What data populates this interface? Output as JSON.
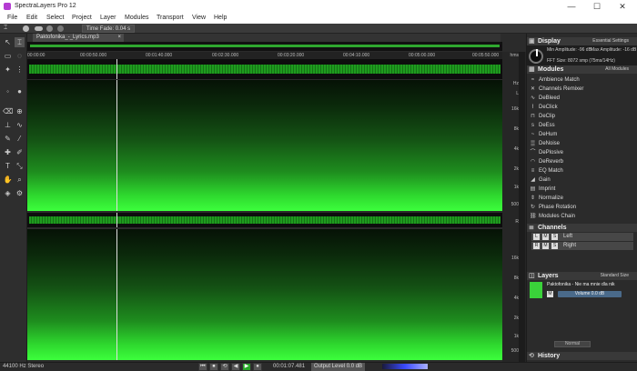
{
  "app": {
    "title": "SpectraLayers Pro 12"
  },
  "window_controls": {
    "minimize": "—",
    "maximize": "☐",
    "close": "✕"
  },
  "menu": [
    "File",
    "Edit",
    "Select",
    "Project",
    "Layer",
    "Modules",
    "Transport",
    "View",
    "Help"
  ],
  "tool_options": {
    "time_fade": "Time Fade: 0.04 s"
  },
  "document": {
    "tab_label": "Paktofonika_-_Lyrics.mp3",
    "tab_close": "×"
  },
  "ruler": {
    "hms": "hms",
    "ticks": [
      "00:00:00",
      "00:00:50.000",
      "00:01:40.000",
      "00:02:30.000",
      "00:03:20.000",
      "00:04:10.000",
      "00:05:00.000",
      "00:05:50.000"
    ]
  },
  "freq_axis": {
    "hz": "Hz",
    "left_labels": [
      "L",
      "16k",
      "8k",
      "4k",
      "2k",
      "1k",
      "500"
    ],
    "right_labels": [
      "R",
      "16k",
      "8k",
      "4k",
      "2k",
      "1k",
      "500"
    ]
  },
  "display_panel": {
    "title": "Display",
    "option": "Essential Settings",
    "min_amp": "Min Amplitude: -96 dB",
    "max_amp": "Max Amplitude: -16 dB",
    "fft": "FFT Size: 8072 smp (75ms/14Hz)"
  },
  "modules_panel": {
    "title": "Modules",
    "option": "All Modules",
    "items": [
      {
        "icon": "ambience-icon",
        "label": "Ambience Match"
      },
      {
        "icon": "remixer-icon",
        "label": "Channels Remixer"
      },
      {
        "icon": "debleed-icon",
        "label": "DeBleed"
      },
      {
        "icon": "declick-icon",
        "label": "DeClick"
      },
      {
        "icon": "declip-icon",
        "label": "DeClip"
      },
      {
        "icon": "deess-icon",
        "label": "DeEss"
      },
      {
        "icon": "dehum-icon",
        "label": "DeHum"
      },
      {
        "icon": "denoise-icon",
        "label": "DeNoise"
      },
      {
        "icon": "deplosive-icon",
        "label": "DePlosive"
      },
      {
        "icon": "dereverb-icon",
        "label": "DeReverb"
      },
      {
        "icon": "eq-match-icon",
        "label": "EQ Match"
      },
      {
        "icon": "gain-icon",
        "label": "Gain"
      },
      {
        "icon": "imprint-icon",
        "label": "Imprint"
      },
      {
        "icon": "normalize-icon",
        "label": "Normalize"
      },
      {
        "icon": "phase-rotation-icon",
        "label": "Phase Rotation"
      },
      {
        "icon": "modules-chain-icon",
        "label": "Modules Chain"
      }
    ]
  },
  "channels_panel": {
    "title": "Channels",
    "items": [
      {
        "tag": "L",
        "name": "Left"
      },
      {
        "tag": "R",
        "name": "Right"
      }
    ],
    "m": "M",
    "s": "S"
  },
  "layers_panel": {
    "title": "Layers",
    "option": "Standard Size",
    "layer_name": "Paktofonika - Nie ma mnie dla nik",
    "volume": "Volume 0.0 dB",
    "blend_mode": "Normal"
  },
  "history_panel": {
    "title": "History"
  },
  "status": {
    "format": "44100 Hz Stereo",
    "position": "00:01:07.481",
    "output_level": "Output Level 0.0 dB"
  },
  "transport": {
    "rewind": "⏮",
    "stop_begin": "⏹",
    "loop": "⟲",
    "prev": "◀",
    "play": "▶",
    "record": "●"
  },
  "colors": {
    "accent": "#2ed82e",
    "brand": "#b43cd2"
  }
}
